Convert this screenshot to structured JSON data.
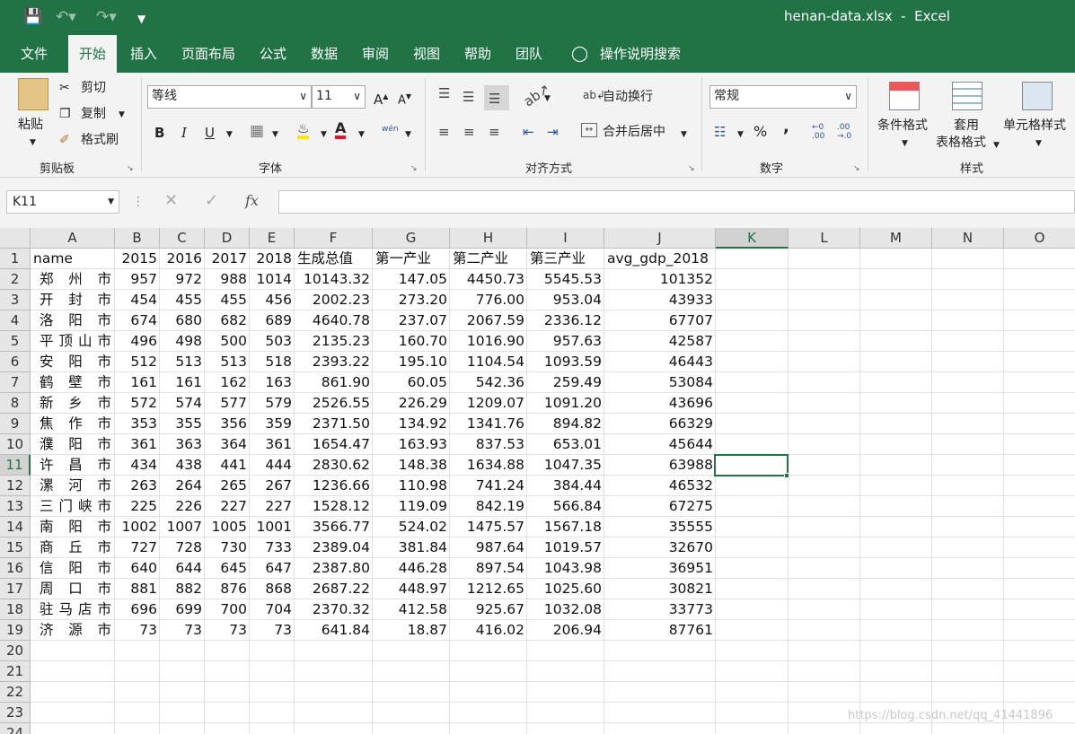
{
  "window": {
    "title": "henan-data.xlsx  -  Excel"
  },
  "tabs": [
    "文件",
    "开始",
    "插入",
    "页面布局",
    "公式",
    "数据",
    "审阅",
    "视图",
    "帮助",
    "团队",
    "操作说明搜索"
  ],
  "ribbon": {
    "clipboard": {
      "paste": "粘贴",
      "cut": "剪切",
      "copy": "复制",
      "format_painter": "格式刷",
      "group": "剪贴板"
    },
    "font": {
      "name": "等线",
      "size": "11",
      "grow": "A",
      "shrink": "A",
      "bold": "B",
      "italic": "I",
      "underline": "U",
      "phonetic": "wén",
      "group": "字体"
    },
    "alignment": {
      "wrap": "自动换行",
      "merge": "合并后居中",
      "group": "对齐方式"
    },
    "number": {
      "format": "常规",
      "percent": "%",
      "comma": ",",
      "inc_decimal": ".00",
      "dec_decimal": ".0",
      "group": "数字"
    },
    "styles": {
      "cond_line1": "条件格式",
      "table_line1": "套用",
      "table_line2": "表格格式",
      "cell_styles": "单元格样式",
      "group": "样式"
    }
  },
  "formula_bar": {
    "name_box": "K11",
    "fx": "fx",
    "formula": ""
  },
  "sheet": {
    "columns": [
      "A",
      "B",
      "C",
      "D",
      "E",
      "F",
      "G",
      "H",
      "I",
      "J",
      "K",
      "L",
      "M",
      "N",
      "O"
    ],
    "rows": [
      "1",
      "2",
      "3",
      "4",
      "5",
      "6",
      "7",
      "8",
      "9",
      "10",
      "11",
      "12",
      "13",
      "14",
      "15",
      "16",
      "17",
      "18",
      "19",
      "20",
      "21",
      "22",
      "23",
      "24"
    ],
    "headers": [
      "name",
      "2015",
      "2016",
      "2017",
      "2018",
      "生成总值",
      "第一产业",
      "第二产业",
      "第三产业",
      "avg_gdp_2018"
    ],
    "data": [
      [
        "郑州市",
        "957",
        "972",
        "988",
        "1014",
        "10143.32",
        "147.05",
        "4450.73",
        "5545.53",
        "101352"
      ],
      [
        "开封市",
        "454",
        "455",
        "455",
        "456",
        "2002.23",
        "273.20",
        "776.00",
        "953.04",
        "43933"
      ],
      [
        "洛阳市",
        "674",
        "680",
        "682",
        "689",
        "4640.78",
        "237.07",
        "2067.59",
        "2336.12",
        "67707"
      ],
      [
        "平顶山市",
        "496",
        "498",
        "500",
        "503",
        "2135.23",
        "160.70",
        "1016.90",
        "957.63",
        "42587"
      ],
      [
        "安阳市",
        "512",
        "513",
        "513",
        "518",
        "2393.22",
        "195.10",
        "1104.54",
        "1093.59",
        "46443"
      ],
      [
        "鹤壁市",
        "161",
        "161",
        "162",
        "163",
        "861.90",
        "60.05",
        "542.36",
        "259.49",
        "53084"
      ],
      [
        "新乡市",
        "572",
        "574",
        "577",
        "579",
        "2526.55",
        "226.29",
        "1209.07",
        "1091.20",
        "43696"
      ],
      [
        "焦作市",
        "353",
        "355",
        "356",
        "359",
        "2371.50",
        "134.92",
        "1341.76",
        "894.82",
        "66329"
      ],
      [
        "濮阳市",
        "361",
        "363",
        "364",
        "361",
        "1654.47",
        "163.93",
        "837.53",
        "653.01",
        "45644"
      ],
      [
        "许昌市",
        "434",
        "438",
        "441",
        "444",
        "2830.62",
        "148.38",
        "1634.88",
        "1047.35",
        "63988"
      ],
      [
        "漯河市",
        "263",
        "264",
        "265",
        "267",
        "1236.66",
        "110.98",
        "741.24",
        "384.44",
        "46532"
      ],
      [
        "三门峡市",
        "225",
        "226",
        "227",
        "227",
        "1528.12",
        "119.09",
        "842.19",
        "566.84",
        "67275"
      ],
      [
        "南阳市",
        "1002",
        "1007",
        "1005",
        "1001",
        "3566.77",
        "524.02",
        "1475.57",
        "1567.18",
        "35555"
      ],
      [
        "商丘市",
        "727",
        "728",
        "730",
        "733",
        "2389.04",
        "381.84",
        "987.64",
        "1019.57",
        "32670"
      ],
      [
        "信阳市",
        "640",
        "644",
        "645",
        "647",
        "2387.80",
        "446.28",
        "897.54",
        "1043.98",
        "36951"
      ],
      [
        "周口市",
        "881",
        "882",
        "876",
        "868",
        "2687.22",
        "448.97",
        "1212.65",
        "1025.60",
        "30821"
      ],
      [
        "驻马店市",
        "696",
        "699",
        "700",
        "704",
        "2370.32",
        "412.58",
        "925.67",
        "1032.08",
        "33773"
      ],
      [
        "济源市",
        "73",
        "73",
        "73",
        "73",
        "641.84",
        "18.87",
        "416.02",
        "206.94",
        "87761"
      ]
    ],
    "selected_cell": "K11"
  },
  "watermark": "https://blog.csdn.net/qq_41441896",
  "colors": {
    "accent": "#217346",
    "ribbon_bg": "#f3f3f3",
    "grid_line": "#e1e1e1"
  }
}
